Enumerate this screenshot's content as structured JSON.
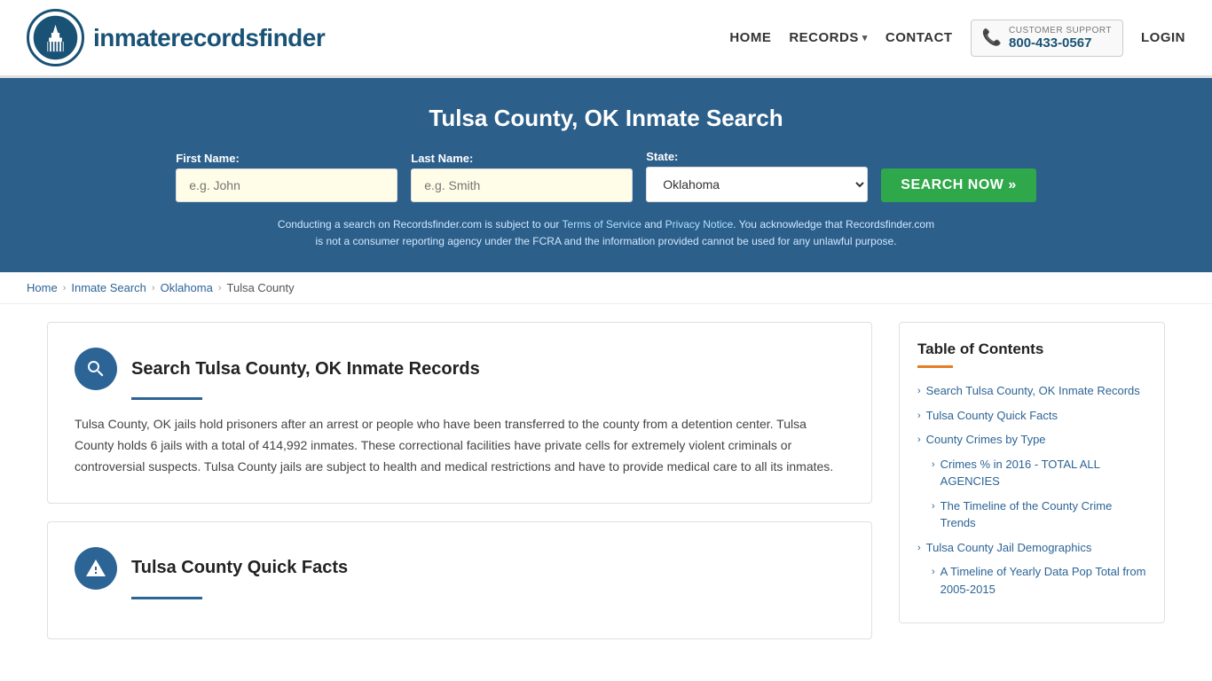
{
  "header": {
    "logo_text_regular": "inmaterecords",
    "logo_text_bold": "finder",
    "nav": {
      "home": "HOME",
      "records": "RECORDS",
      "contact": "CONTACT",
      "login": "LOGIN",
      "customer_support_label": "CUSTOMER SUPPORT",
      "customer_support_number": "800-433-0567"
    }
  },
  "hero": {
    "title": "Tulsa County, OK Inmate Search",
    "form": {
      "first_name_label": "First Name:",
      "first_name_placeholder": "e.g. John",
      "last_name_label": "Last Name:",
      "last_name_placeholder": "e.g. Smith",
      "state_label": "State:",
      "state_value": "Oklahoma",
      "search_button": "SEARCH NOW »"
    },
    "disclaimer": "Conducting a search on Recordsfinder.com is subject to our Terms of Service and Privacy Notice. You acknowledge that Recordsfinder.com is not a consumer reporting agency under the FCRA and the information provided cannot be used for any unlawful purpose."
  },
  "breadcrumb": {
    "home": "Home",
    "inmate_search": "Inmate Search",
    "oklahoma": "Oklahoma",
    "tulsa_county": "Tulsa County"
  },
  "main": {
    "card1": {
      "title": "Search Tulsa County, OK Inmate Records",
      "body": "Tulsa County, OK jails hold prisoners after an arrest or people who have been transferred to the county from a detention center. Tulsa County holds 6 jails with a total of 414,992 inmates. These correctional facilities have private cells for extremely violent criminals or controversial suspects. Tulsa County jails are subject to health and medical restrictions and have to provide medical care to all its inmates."
    },
    "card2": {
      "title": "Tulsa County Quick Facts"
    }
  },
  "toc": {
    "title": "Table of Contents",
    "items": [
      {
        "label": "Search Tulsa County, OK Inmate Records",
        "sub": false
      },
      {
        "label": "Tulsa County Quick Facts",
        "sub": false
      },
      {
        "label": "County Crimes by Type",
        "sub": false
      },
      {
        "label": "Crimes % in 2016 - TOTAL ALL AGENCIES",
        "sub": true
      },
      {
        "label": "The Timeline of the County Crime Trends",
        "sub": true
      },
      {
        "label": "Tulsa County Jail Demographics",
        "sub": false
      },
      {
        "label": "A Timeline of Yearly Data Pop Total from 2005-2015",
        "sub": true
      }
    ]
  }
}
